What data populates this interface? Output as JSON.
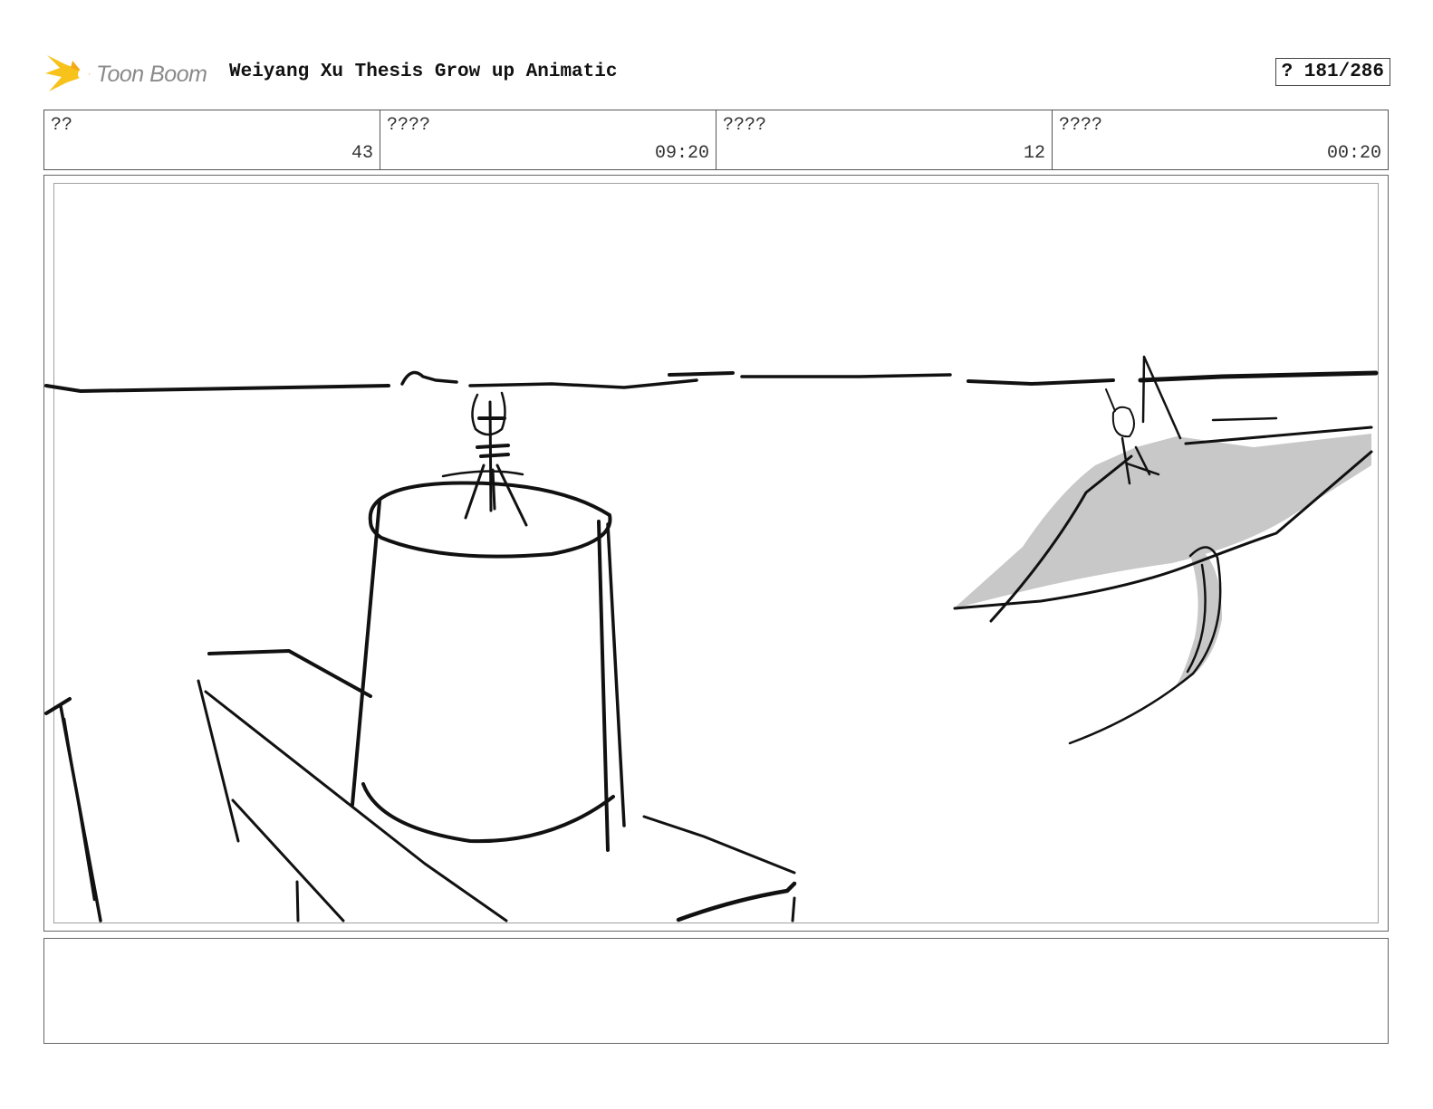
{
  "header": {
    "logo_text": "Toon Boom",
    "title": "Weiyang Xu Thesis Grow up Animatic",
    "page_indicator": "? 181/286"
  },
  "info": [
    {
      "label": "??",
      "value": "43"
    },
    {
      "label": "????",
      "value": "09:20"
    },
    {
      "label": "????",
      "value": "12"
    },
    {
      "label": "????",
      "value": "00:20"
    }
  ],
  "panel": {
    "content": "rough storyboard sketch"
  },
  "notes": {
    "text": ""
  },
  "colors": {
    "logo_flame": "#f7c21a",
    "fin_fill": "#c8c8c8",
    "border": "#666666"
  }
}
